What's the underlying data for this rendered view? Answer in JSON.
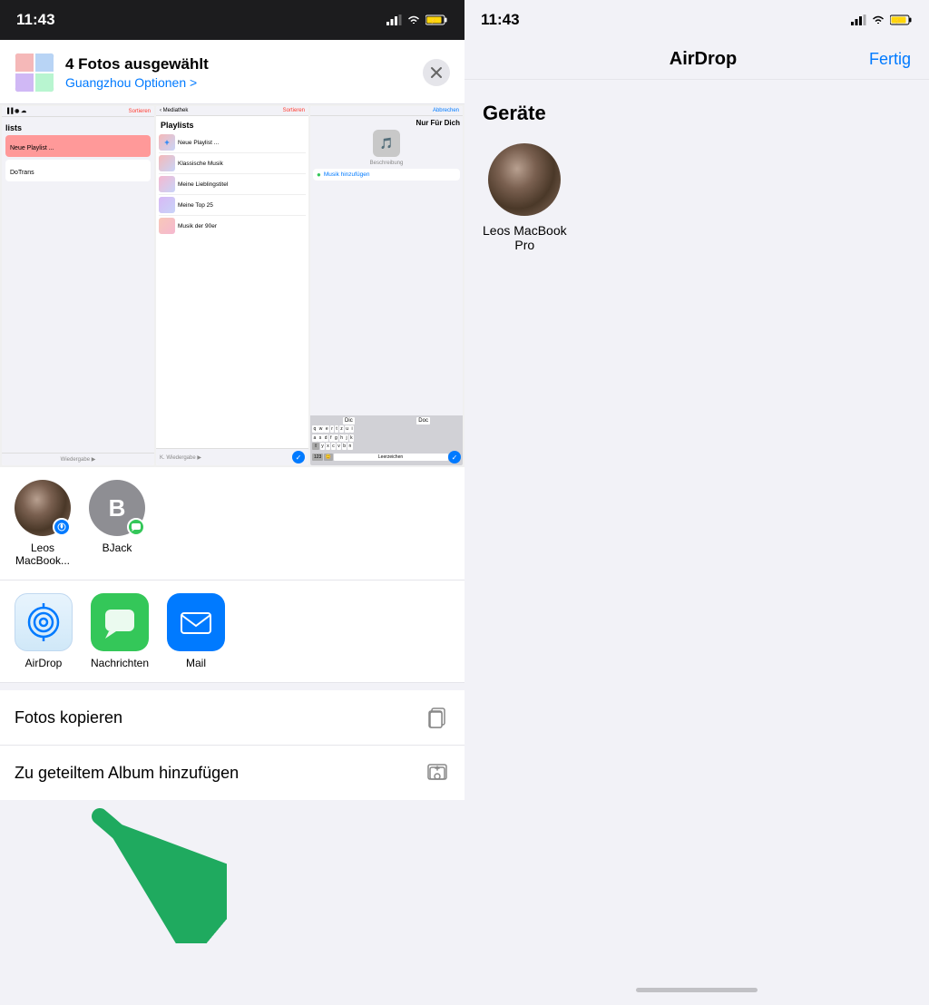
{
  "left": {
    "status_time": "11:43",
    "share_header": {
      "title": "4 Fotos ausgewählt",
      "subtitle_prefix": "Guangzhou",
      "subtitle_link": "Optionen >",
      "close_label": "×"
    },
    "contacts": [
      {
        "name_line1": "Leos",
        "name_line2": "MacBook...",
        "has_airdrop_badge": true,
        "type": "photo"
      },
      {
        "name_line1": "BJack",
        "name_line2": "",
        "has_messages_badge": true,
        "type": "initial",
        "initial": "B"
      }
    ],
    "apps": [
      {
        "name": "AirDrop",
        "type": "airdrop"
      },
      {
        "name": "Nachrichten",
        "type": "messages"
      },
      {
        "name": "Mail",
        "type": "mail"
      }
    ],
    "actions": [
      {
        "label": "Fotos kopieren",
        "icon": "copy"
      },
      {
        "label": "Zu geteiltem Album hinzufügen",
        "icon": "album"
      }
    ]
  },
  "right": {
    "status_time": "11:43",
    "title": "AirDrop",
    "done_label": "Fertig",
    "section": "Geräte",
    "devices": [
      {
        "name_line1": "Leos MacBook",
        "name_line2": "Pro",
        "type": "photo"
      }
    ]
  },
  "preview_screenshots": {
    "ss1": {
      "label": "lists",
      "items": [
        "Neue Playlist ...",
        "DoTrans"
      ]
    },
    "ss2": {
      "label": "Playlists",
      "items": [
        "Neue Playlist ...",
        "Klassische Musik",
        "Meine Lieblingstitel",
        "Meine Top 25",
        "Musik der 90er"
      ]
    },
    "ss3": {
      "label": "Nur Für Dich",
      "keyboard_rows": [
        [
          "q",
          "w",
          "e",
          "r",
          "t",
          "z",
          "u",
          "i"
        ],
        [
          "a",
          "s",
          "d",
          "f",
          "g",
          "h",
          "j",
          "k"
        ],
        [
          "⇧",
          "y",
          "x",
          "c",
          "v",
          "b",
          "n"
        ],
        [
          "123",
          "😊",
          "Leerzeichen",
          "↵"
        ]
      ]
    }
  }
}
